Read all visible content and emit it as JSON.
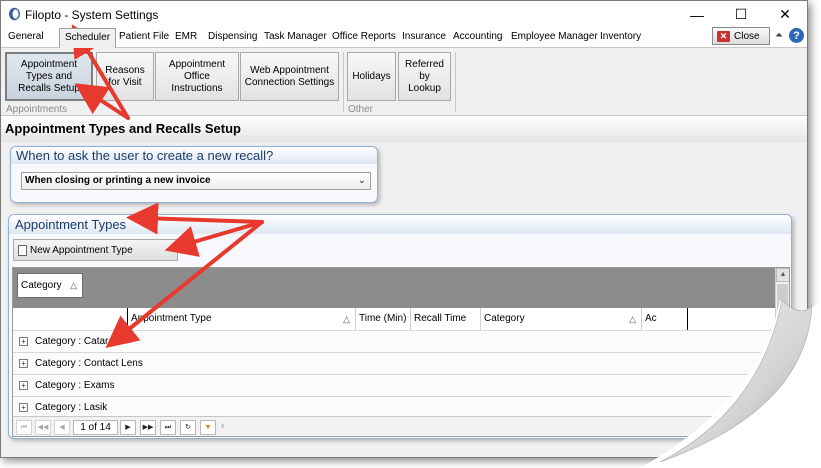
{
  "window": {
    "title": "Filopto - System Settings",
    "minimize_glyph": "—",
    "maximize_glyph": "☐",
    "close_glyph": "✕"
  },
  "menu": {
    "tabs": [
      "General",
      "Scheduler",
      "Patient File",
      "EMR",
      "Dispensing",
      "Task Manager",
      "Office Reports",
      "Insurance",
      "Accounting",
      "Employee Manager",
      "Inventory"
    ],
    "active_tab": "Scheduler",
    "close_label": "Close"
  },
  "ribbon": {
    "appointment_types": "Appointment Types and Recalls Setup",
    "reasons": "Reasons for Visit",
    "office_instructions": "Appointment Office Instructions",
    "web_connection": "Web Appointment Connection Settings",
    "holidays": "Holidays",
    "referred": "Referred by Lookup",
    "group_appointments": "Appointments",
    "group_other": "Other"
  },
  "page": {
    "title": "Appointment Types and Recalls Setup"
  },
  "recall_panel": {
    "heading": "When to ask the user to create a new recall?",
    "selected_value": "When closing or printing a new invoice"
  },
  "types_panel": {
    "heading": "Appointment Types",
    "new_button": "New Appointment Type"
  },
  "grid": {
    "group_by": "Category",
    "columns": [
      "Appointment Type",
      "Time (Min)",
      "Recall Time",
      "Category",
      "Ac"
    ],
    "rows": [
      "Category : Cataract",
      "Category : Contact Lens",
      "Category : Exams",
      "Category : Lasik"
    ],
    "pager_info": "1 of 14"
  },
  "colors": {
    "accent_blue": "#1c3d6b",
    "panel_border": "#8fb2d9",
    "annotation_red": "#e8392e",
    "close_red": "#c8322e"
  }
}
